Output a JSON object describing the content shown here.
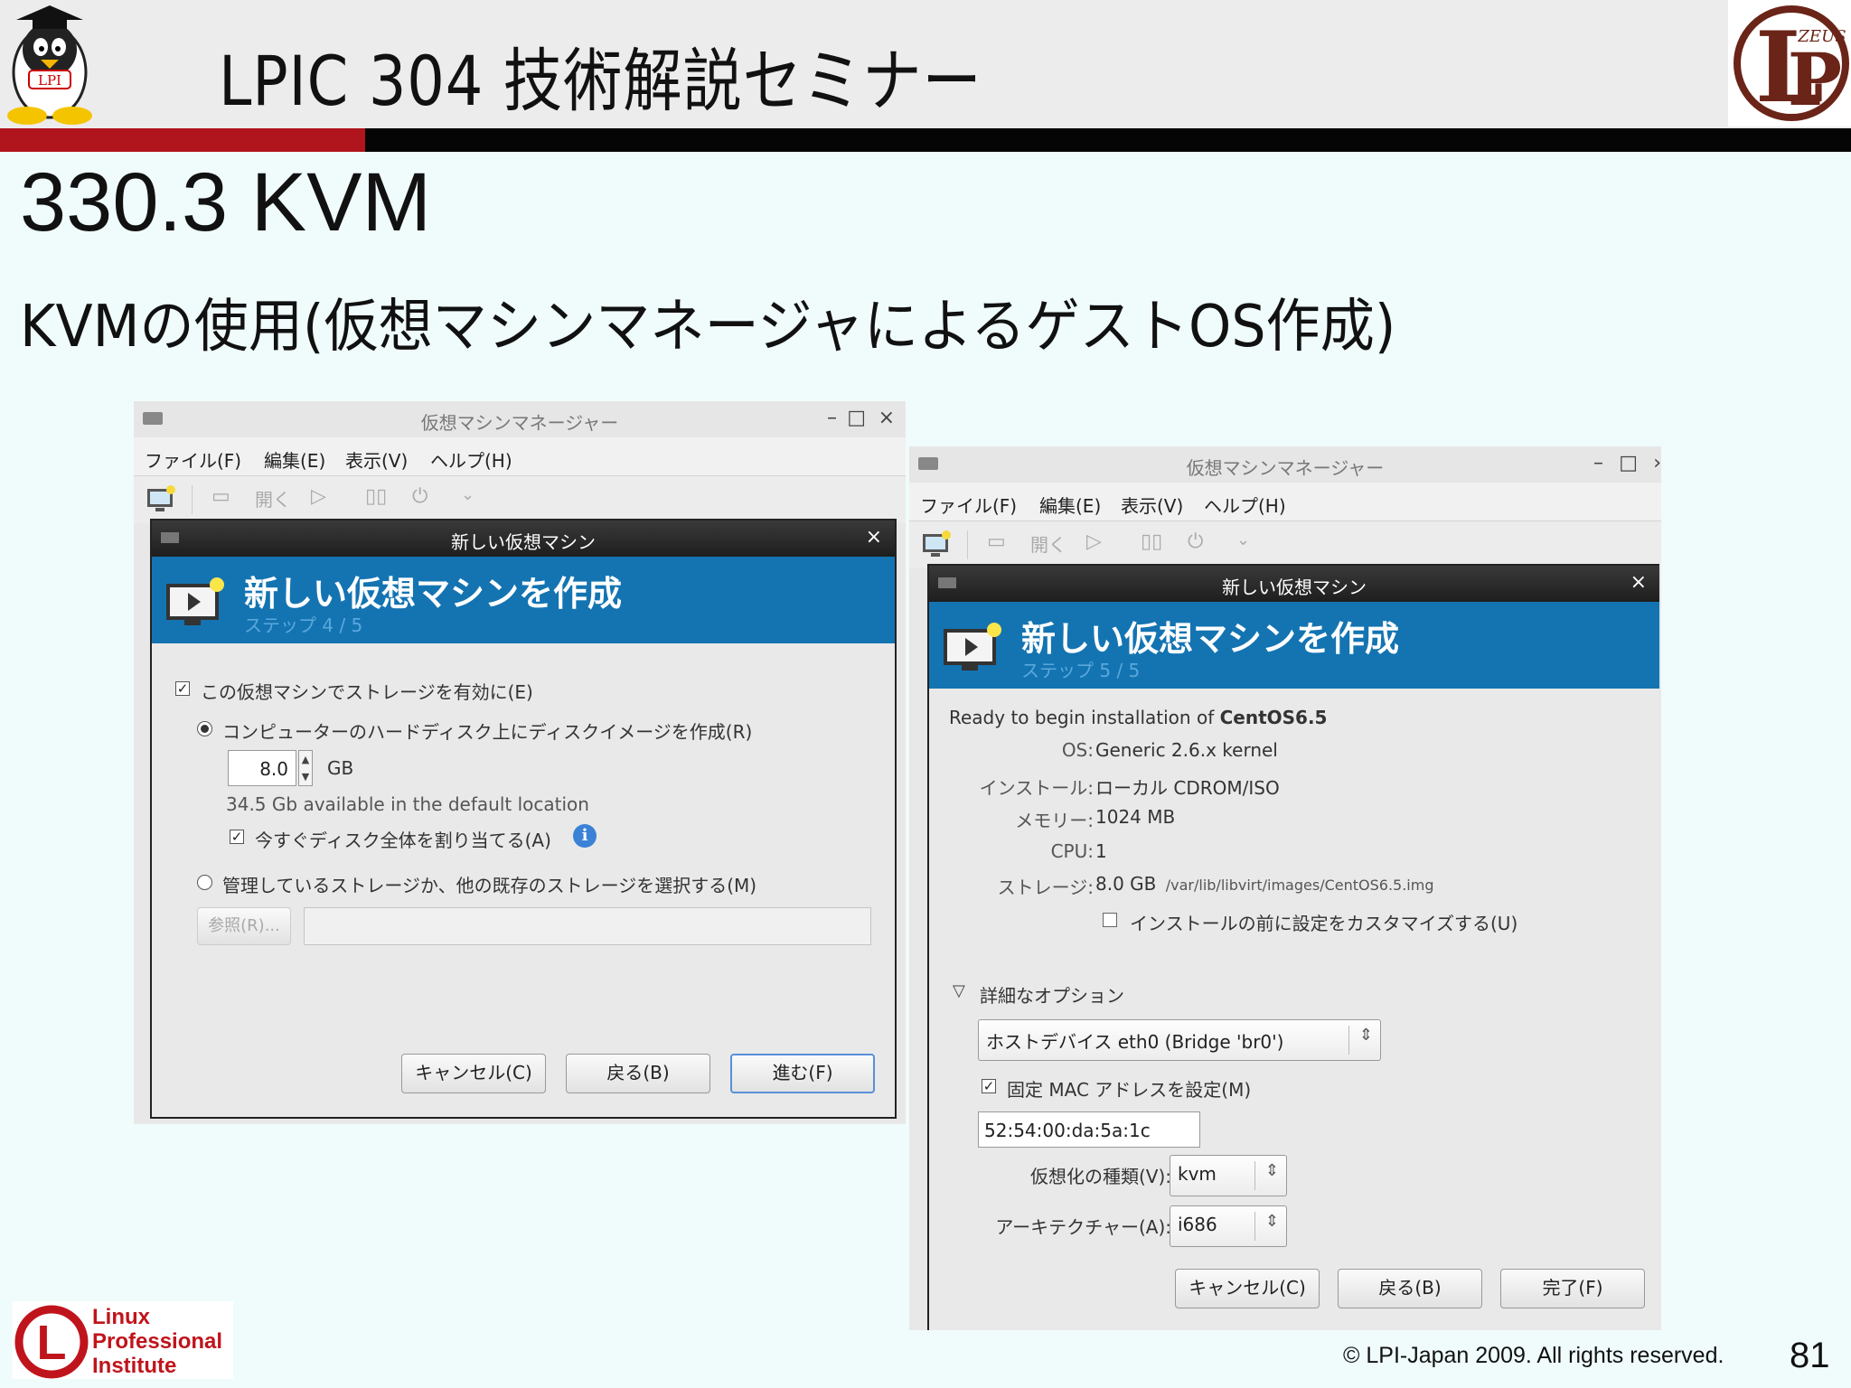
{
  "slide": {
    "title": "LPIC 304 技術解説セミナー",
    "section": "330.3 KVM",
    "subtitle": "KVMの使用(仮想マシンマネージャによるゲストOS作成)",
    "copyright": "© LPI-Japan 2009. All rights reserved.",
    "page_number": "81",
    "footer_logo_lines": [
      "Linux",
      "Professional",
      "Institute"
    ],
    "corner_logo_text": "ZEUS",
    "penguin_badge": "LPI"
  },
  "colors": {
    "accent_red": "#b0141c",
    "banner_blue": "#1474b2",
    "slide_bg": "#f0fcfc"
  },
  "left_window": {
    "title": "仮想マシンマネージャー",
    "menu": [
      "ファイル(F)",
      "編集(E)",
      "表示(V)",
      "ヘルプ(H)"
    ],
    "toolbar_open": "開く",
    "dialog": {
      "title": "新しい仮想マシン",
      "heading": "新しい仮想マシンを作成",
      "step": "ステップ 4 / 5",
      "enable_storage": "この仮想マシンでストレージを有効に(E)",
      "create_disk": "コンピューターのハードディスク上にディスクイメージを作成(R)",
      "disk_size": "8.0",
      "disk_unit": "GB",
      "available": "34.5 Gb available in the default location",
      "allocate_now": "今すぐディスク全体を割り当てる(A)",
      "select_managed": "管理しているストレージか、他の既存のストレージを選択する(M)",
      "browse": "参照(R)...",
      "path_value": "",
      "cancel": "キャンセル(C)",
      "back": "戻る(B)",
      "forward": "進む(F)"
    }
  },
  "right_window": {
    "title": "仮想マシンマネージャー",
    "menu": [
      "ファイル(F)",
      "編集(E)",
      "表示(V)",
      "ヘルプ(H)"
    ],
    "toolbar_open": "開く",
    "dialog": {
      "title": "新しい仮想マシン",
      "heading": "新しい仮想マシンを作成",
      "step": "ステップ 5 / 5",
      "ready_prefix": "Ready to begin installation of ",
      "vm_name": "CentOS6.5",
      "summary": [
        {
          "label": "OS:",
          "value": "Generic 2.6.x kernel",
          "extra": ""
        },
        {
          "label": "インストール:",
          "value": "ローカル CDROM/ISO",
          "extra": ""
        },
        {
          "label": "メモリー:",
          "value": "1024 MB",
          "extra": ""
        },
        {
          "label": "CPU:",
          "value": "1",
          "extra": ""
        },
        {
          "label": "ストレージ:",
          "value": "8.0 GB",
          "extra": "/var/lib/libvirt/images/CentOS6.5.img"
        }
      ],
      "customize": "インストールの前に設定をカスタマイズする(U)",
      "advanced": "詳細なオプション",
      "host_device": "ホストデバイス eth0 (Bridge 'br0')",
      "fixed_mac": "固定 MAC アドレスを設定(M)",
      "mac_value": "52:54:00:da:5a:1c",
      "virt_type_label": "仮想化の種類(V):",
      "virt_type": "kvm",
      "arch_label": "アーキテクチャー(A):",
      "arch": "i686",
      "cancel": "キャンセル(C)",
      "back": "戻る(B)",
      "finish": "完了(F)"
    }
  }
}
